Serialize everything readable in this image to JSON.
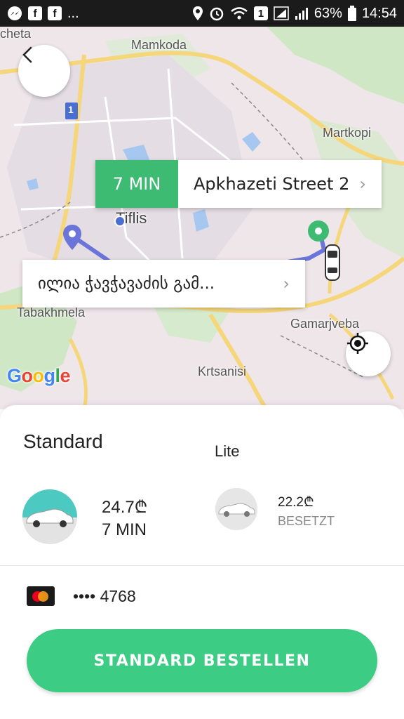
{
  "status_bar": {
    "battery_percent": "63%",
    "time": "14:54",
    "notification_dots": "...",
    "badge_1": "1"
  },
  "map": {
    "labels": {
      "mamkoda": "Mamkoda",
      "cheta": "cheta",
      "martkopi": "Martkopi",
      "tiflis": "Tiflis",
      "tabakhmela": "Tabakhmela",
      "gamarjveba": "Gamarjveba",
      "krtsanisi": "Krtsanisi",
      "road_shield": "1"
    },
    "google_logo": [
      "G",
      "o",
      "o",
      "g",
      "l",
      "e"
    ],
    "eta_card": {
      "time": "7 MIN",
      "destination": "Apkhazeti Street 2"
    },
    "pickup_card": {
      "address": "ილია ჭავჭავაძის გამ..."
    },
    "route_color": "#6b74d8",
    "destination_pin_color": "#3dbb72"
  },
  "tiers": {
    "standard": {
      "title": "Standard",
      "price": "24.7₾",
      "eta": "7 MIN"
    },
    "lite": {
      "title": "Lite",
      "price": "22.2₾",
      "status": "BESETZT"
    }
  },
  "payment": {
    "card_number": "•••• 4768",
    "card_icon": "mastercard-icon"
  },
  "order_button": {
    "label": "STANDARD BESTELLEN",
    "color": "#3dcc84"
  }
}
